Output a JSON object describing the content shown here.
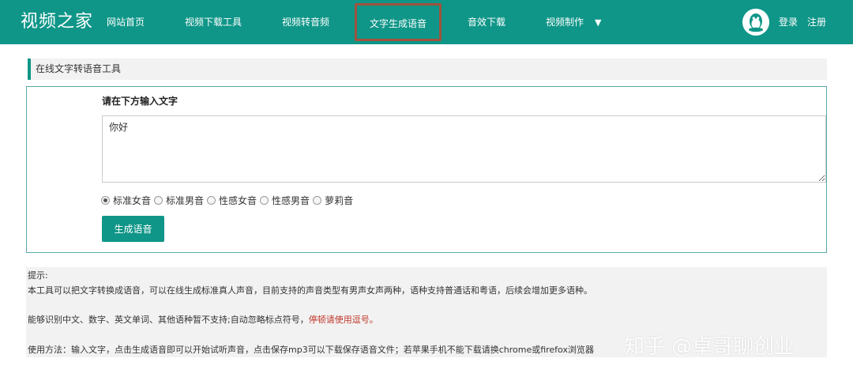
{
  "header": {
    "logo": "视频之家",
    "nav": [
      {
        "label": "网站首页"
      },
      {
        "label": "视频下载工具"
      },
      {
        "label": "视频转音频"
      },
      {
        "label": "文字生成语音",
        "active": true
      },
      {
        "label": "音效下载"
      },
      {
        "label": "视频制作"
      }
    ],
    "login": "登录",
    "register": "注册",
    "avatar_icon": "qq-penguin-icon"
  },
  "section": {
    "title": "在线文字转语音工具"
  },
  "form": {
    "label": "请在下方输入文字",
    "text_value": "你好",
    "voices": [
      {
        "label": "标准女音",
        "checked": true
      },
      {
        "label": "标准男音",
        "checked": false
      },
      {
        "label": "性感女音",
        "checked": false
      },
      {
        "label": "性感男音",
        "checked": false
      },
      {
        "label": "萝莉音",
        "checked": false
      }
    ],
    "generate_label": "生成语音"
  },
  "tips": {
    "title": "提示:",
    "line1": "本工具可以把文字转换成语音，可以在线生成标准真人声音，目前支持的声音类型有男声女声两种，语种支持普通话和粤语，后续会增加更多语种。",
    "line2": "能够识别中文、数字、英文单词、其他语种暂不支持;自动忽略标点符号，",
    "line2_warning": "停顿请使用逗号。",
    "line3": "使用方法：输入文字，点击生成语音即可以开始试听声音，点击保存mp3可以下载保存语音文件；若苹果手机不能下载请换chrome或firefox浏览器"
  },
  "watermark": "知乎 @卓哥聊创业",
  "colors": {
    "brand": "#0f9688",
    "active_outline": "#a0523d",
    "warning": "#c0392b"
  }
}
